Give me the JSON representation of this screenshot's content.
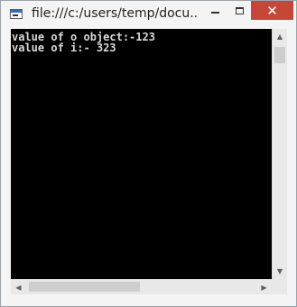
{
  "window": {
    "title": "file:///c:/users/temp/docu...",
    "icon": "console-app-icon",
    "controls": {
      "minimize_icon": "minimize-icon",
      "maximize_icon": "maximize-icon",
      "close_glyph": "✕"
    }
  },
  "console": {
    "background": "#000000",
    "text_color": "#d8d8d8",
    "lines": [
      "value of o object:-123",
      "value of i:- 323"
    ]
  },
  "scrollbars": {
    "vertical": {
      "up_glyph": "▲",
      "down_glyph": "▼"
    },
    "horizontal": {
      "left_glyph": "◀",
      "right_glyph": "▶"
    }
  },
  "colors": {
    "close_button": "#c7463a",
    "chrome": "#f4f4f4"
  }
}
